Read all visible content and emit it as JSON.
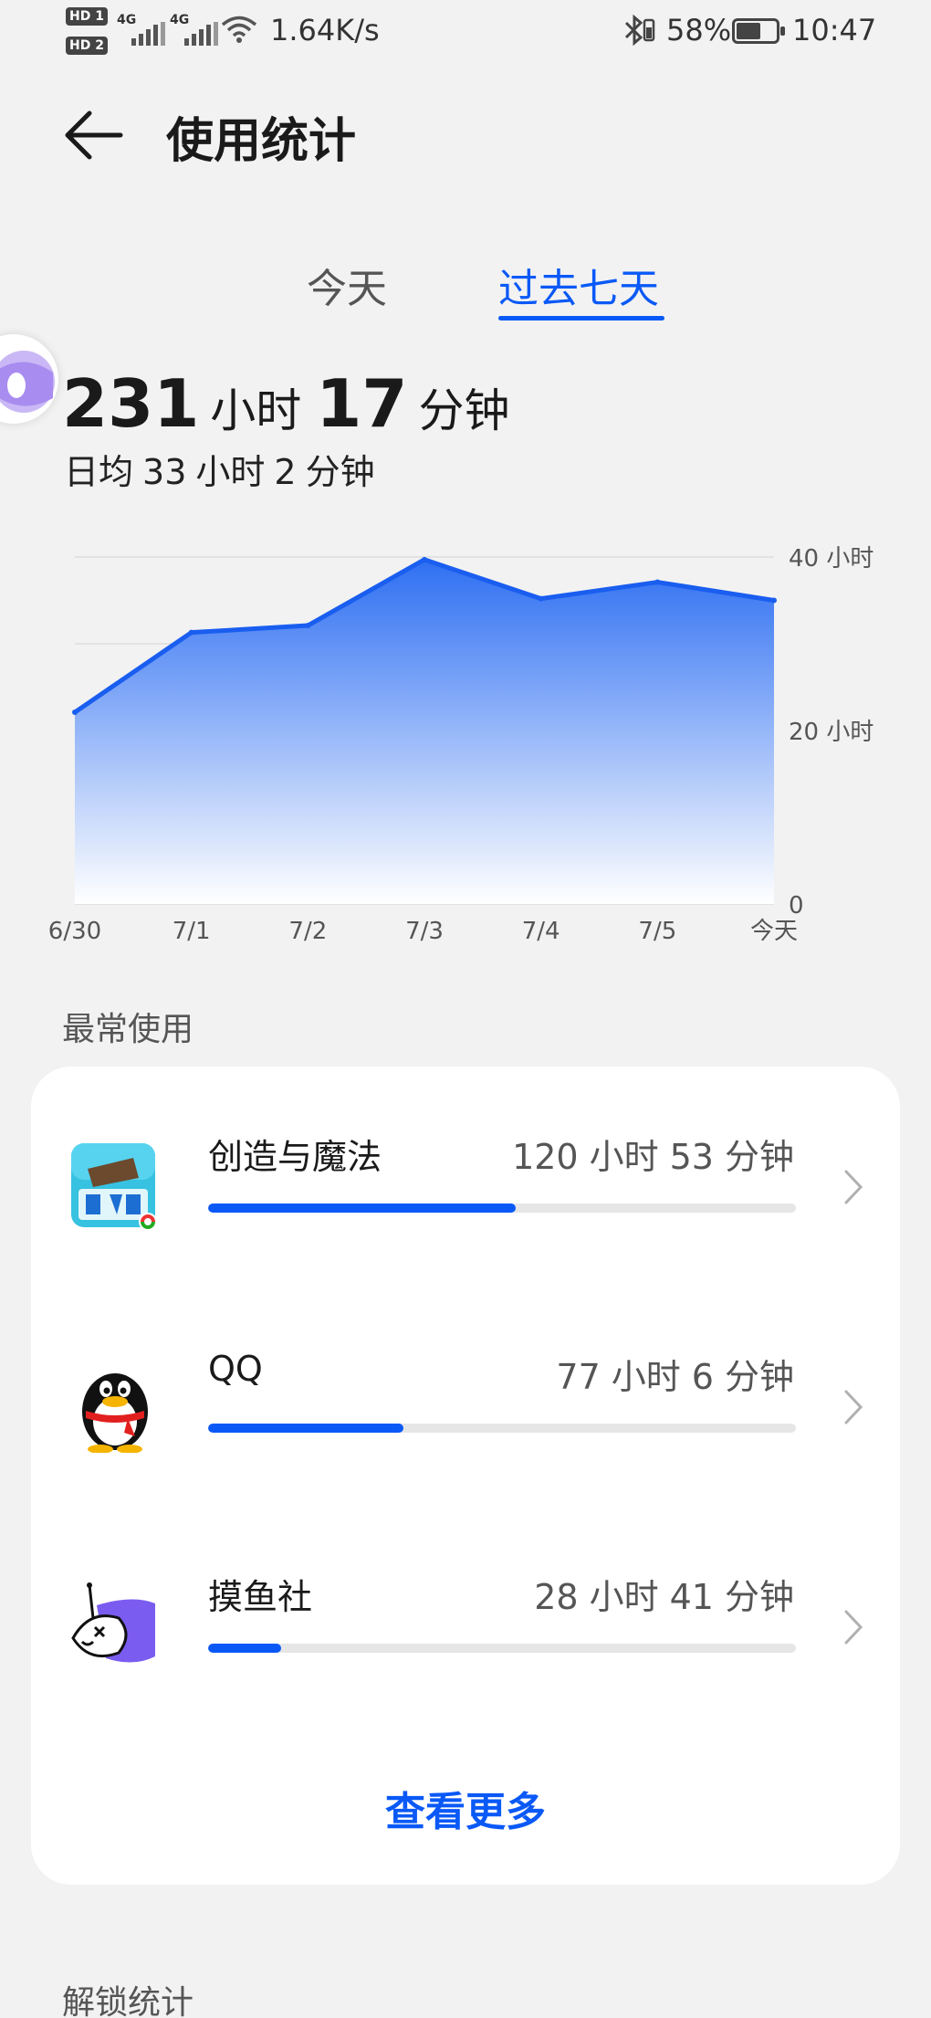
{
  "status_bar": {
    "hd1": "HD 1",
    "hd2": "HD 2",
    "net1": "4G",
    "net2": "4G",
    "speed": "1.64K/s",
    "battery_pct": "58%",
    "battery_level": 0.58,
    "time": "10:47"
  },
  "header": {
    "title": "使用统计"
  },
  "tabs": [
    {
      "label": "今天",
      "selected": false
    },
    {
      "label": "过去七天",
      "selected": true
    }
  ],
  "summary": {
    "hours": "231",
    "hours_unit": "小时",
    "minutes": "17",
    "minutes_unit": "分钟",
    "avg_prefix": "日均",
    "avg_hours": "33",
    "avg_hours_unit": "小时",
    "avg_minutes": "2",
    "avg_minutes_unit": "分钟"
  },
  "chart_data": {
    "type": "area",
    "x": [
      "6/30",
      "7/1",
      "7/2",
      "7/3",
      "7/4",
      "7/5",
      "今天"
    ],
    "y": [
      22.1,
      31.3,
      32.1,
      39.7,
      35.2,
      37.1,
      35.0
    ],
    "y_unit": "小时",
    "ylim": [
      0,
      40
    ],
    "y_ticks": [
      "40 小时",
      "20 小时",
      "0"
    ],
    "grid": true,
    "colors": {
      "line": "#1a5ef0",
      "fill_top": "#2e6ff2",
      "fill_bottom": "#ffffff"
    }
  },
  "most_used": {
    "title": "最常使用",
    "apps": [
      {
        "name": "创造与魔法",
        "hours": "120",
        "hours_unit": "小时",
        "minutes": "53",
        "minutes_unit": "分钟",
        "fraction": 0.523,
        "icon": "game-icon"
      },
      {
        "name": "QQ",
        "hours": "77",
        "hours_unit": "小时",
        "minutes": "6",
        "minutes_unit": "分钟",
        "fraction": 0.333,
        "icon": "qq-penguin-icon"
      },
      {
        "name": "摸鱼社",
        "hours": "28",
        "hours_unit": "小时",
        "minutes": "41",
        "minutes_unit": "分钟",
        "fraction": 0.124,
        "icon": "fish-icon"
      }
    ],
    "see_more": "查看更多"
  },
  "unlock_section": {
    "title": "解锁统计"
  },
  "colors": {
    "accent": "#0a59f7",
    "background": "#f2f2f2",
    "card": "#ffffff"
  }
}
